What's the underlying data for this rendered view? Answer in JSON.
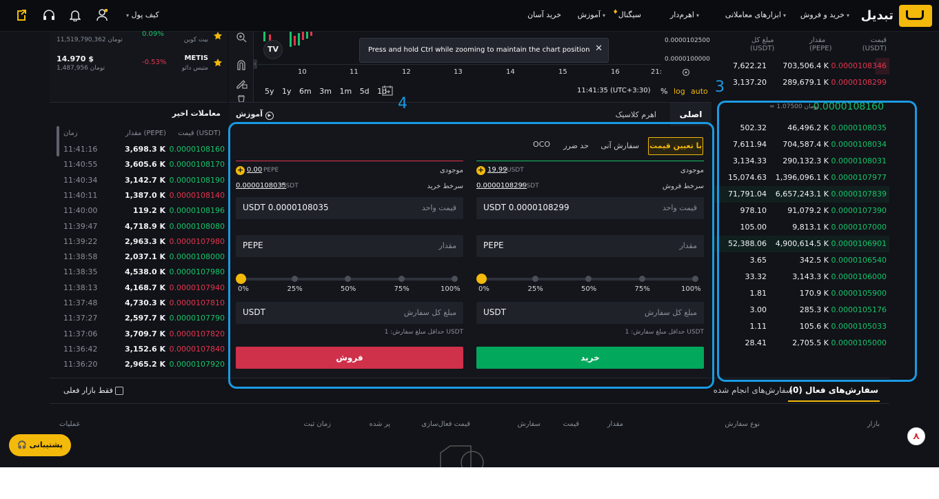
{
  "header": {
    "logo": "تبدیل",
    "nav": [
      "خرید و فروش",
      "ابزارهای معاملاتی",
      "اهرم‌دار",
      "سیگنال",
      "آموزش",
      "خرید آسان"
    ],
    "wallet": "کیف پول"
  },
  "watchlist": [
    {
      "change": "0.09%",
      "name": "بیت کوین",
      "price": "11,519,790,362 تومان"
    },
    {
      "price_usd": "14.970 $",
      "change": "-0.53%",
      "name": "METIS",
      "subname": "متیس دائو",
      "price": "1,487,956 تومان"
    }
  ],
  "chart": {
    "x_ticks": [
      "10",
      "11",
      "12",
      "13",
      "14",
      "15",
      "16",
      "21:"
    ],
    "y_ticks": [
      "0.0000102500",
      "0.0000100000"
    ],
    "timeframes": [
      "5y",
      "1y",
      "6m",
      "3m",
      "1m",
      "5d",
      "1d"
    ],
    "clock": "11:41:35 (UTC+3:30)",
    "pct": "%",
    "log": "log",
    "auto": "auto",
    "tooltip": "Press and hold Ctrl while zooming to maintain the chart position"
  },
  "orderbook": {
    "headers": {
      "price": "قیمت",
      "price_unit": "(USDT)",
      "amount": "مقدار",
      "amount_unit": "(PEPE)",
      "total": "مبلغ کل",
      "total_unit": "(USDT)"
    },
    "asks": [
      {
        "price": "0.0000108346",
        "amount": "703,506.4 K",
        "total": "7,622.21"
      },
      {
        "price": "0.0000108299",
        "amount": "289,679.1 K",
        "total": "3,137.20"
      }
    ],
    "last_price": "0.0000108160",
    "last_price_toman": "≈ 1.07500 تومان",
    "bids": [
      {
        "price": "0.0000108035",
        "amount": "46,496.2 K",
        "total": "502.32"
      },
      {
        "price": "0.0000108034",
        "amount": "704,587.4 K",
        "total": "7,611.94"
      },
      {
        "price": "0.0000108031",
        "amount": "290,132.3 K",
        "total": "3,134.33"
      },
      {
        "price": "0.0000107977",
        "amount": "1,396,096.1 K",
        "total": "15,074.63"
      },
      {
        "price": "0.0000107839",
        "amount": "6,657,243.1 K",
        "total": "71,791.04"
      },
      {
        "price": "0.0000107390",
        "amount": "91,079.2 K",
        "total": "978.10"
      },
      {
        "price": "0.0000107000",
        "amount": "9,813.1 K",
        "total": "105.00"
      },
      {
        "price": "0.0000106901",
        "amount": "4,900,614.5 K",
        "total": "52,388.06"
      },
      {
        "price": "0.0000106540",
        "amount": "342.5 K",
        "total": "3.65"
      },
      {
        "price": "0.0000106000",
        "amount": "3,143.3 K",
        "total": "33.32"
      },
      {
        "price": "0.0000105900",
        "amount": "170.9 K",
        "total": "1.81"
      },
      {
        "price": "0.0000105176",
        "amount": "285.3 K",
        "total": "3.00"
      },
      {
        "price": "0.0000105033",
        "amount": "105.6 K",
        "total": "1.11"
      },
      {
        "price": "0.0000105000",
        "amount": "2,705.5 K",
        "total": "28.41"
      }
    ]
  },
  "annotations": {
    "three": "3",
    "four": "4"
  },
  "recent": {
    "title": "معاملات اخیر",
    "headers": {
      "price": "قیمت (USDT)",
      "amount": "مقدار (PEPE)",
      "time": "زمان"
    },
    "rows": [
      {
        "price": "0.0000108160",
        "amount": "3,698.3 K",
        "time": "11:41:16",
        "side": "buy"
      },
      {
        "price": "0.0000108170",
        "amount": "3,605.6 K",
        "time": "11:40:55",
        "side": "buy"
      },
      {
        "price": "0.0000108190",
        "amount": "3,142.7 K",
        "time": "11:40:34",
        "side": "buy"
      },
      {
        "price": "0.0000108140",
        "amount": "1,387.0 K",
        "time": "11:40:11",
        "side": "sell"
      },
      {
        "price": "0.0000108196",
        "amount": "119.2 K",
        "time": "11:40:00",
        "side": "buy"
      },
      {
        "price": "0.0000108080",
        "amount": "4,718.9 K",
        "time": "11:39:47",
        "side": "buy"
      },
      {
        "price": "0.0000107980",
        "amount": "2,963.3 K",
        "time": "11:39:22",
        "side": "sell"
      },
      {
        "price": "0.0000108000",
        "amount": "2,037.1 K",
        "time": "11:38:58",
        "side": "buy"
      },
      {
        "price": "0.0000107980",
        "amount": "4,538.0 K",
        "time": "11:38:35",
        "side": "buy"
      },
      {
        "price": "0.0000107940",
        "amount": "4,168.7 K",
        "time": "11:38:13",
        "side": "sell"
      },
      {
        "price": "0.0000107810",
        "amount": "4,730.3 K",
        "time": "11:37:48",
        "side": "sell"
      },
      {
        "price": "0.0000107790",
        "amount": "2,597.7 K",
        "time": "11:37:27",
        "side": "buy"
      },
      {
        "price": "0.0000107820",
        "amount": "3,709.7 K",
        "time": "11:37:06",
        "side": "sell"
      },
      {
        "price": "0.0000107840",
        "amount": "3,152.6 K",
        "time": "11:36:42",
        "side": "sell"
      },
      {
        "price": "0.0000107920",
        "amount": "2,965.2 K",
        "time": "11:36:20",
        "side": "buy"
      }
    ]
  },
  "form": {
    "main_tab": "اصلی",
    "classic_tab": "اهرم کلاسیک",
    "learn": "آموزش",
    "order_types": [
      "با تعیین قیمت",
      "سفارش آنی",
      "حد ضرر",
      "OCO"
    ],
    "buy": {
      "balance_label": "موجودی",
      "balance": "19.99",
      "balance_unit": "USDT",
      "rate_label": "سرخط فروش",
      "rate": "0.0000108299",
      "rate_unit": "USDT",
      "price_label": "قیمت واحد",
      "price_value": "USDT 0.0000108299",
      "amount_label": "مقدار",
      "amount_value": "PEPE",
      "total_label": "مبلغ کل سفارش",
      "total_value": "USDT",
      "min_note": "حداقل مبلغ سفارش: 1 USDT",
      "button": "خرید"
    },
    "sell": {
      "balance_label": "موجودی",
      "balance": "0.00",
      "balance_unit": "PEPE",
      "rate_label": "سرخط خرید",
      "rate": "0.0000108035",
      "rate_unit": "USDT",
      "price_label": "قیمت واحد",
      "price_value": "USDT 0.0000108035",
      "amount_label": "مقدار",
      "amount_value": "PEPE",
      "total_label": "مبلغ کل سفارش",
      "total_value": "USDT",
      "min_note": "حداقل مبلغ سفارش: 1 USDT",
      "button": "فروش"
    },
    "slider_labels": [
      "0%",
      "25%",
      "50%",
      "75%",
      "100%"
    ],
    "slider_value_pct": 0
  },
  "orders": {
    "active_tab": "سفارش‌های فعال",
    "active_count": "(0)",
    "done_tab": "سفارش‌های انجام شده",
    "only_current": "فقط بازار فعلی",
    "columns": [
      "بازار",
      "نوع سفارش",
      "مقدار",
      "قیمت",
      "سفارش",
      "قیمت فعال‌سازی",
      "پر شده",
      "زمان ثبت",
      "عملیات"
    ]
  },
  "support": "پشتیبانی",
  "colors": {
    "accent": "#f3b90b",
    "buy": "#02a85b",
    "sell": "#cf304a",
    "highlight": "#1a9be3"
  }
}
